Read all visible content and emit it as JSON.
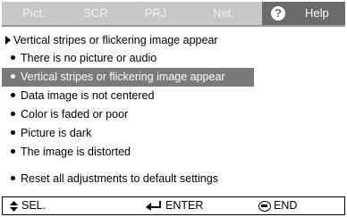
{
  "tabs": [
    {
      "label": "Pict."
    },
    {
      "label": "SCR"
    },
    {
      "label": "PRJ"
    },
    {
      "label": "Net."
    }
  ],
  "help_tab": {
    "icon": "question-icon",
    "icon_glyph": "?",
    "label": "Help"
  },
  "heading": "Vertical stripes or flickering image appear",
  "items": [
    {
      "label": "There is no picture or audio",
      "selected": false
    },
    {
      "label": "Vertical stripes or flickering image appear",
      "selected": true
    },
    {
      "label": "Data image is not centered",
      "selected": false
    },
    {
      "label": "Color is faded or poor",
      "selected": false
    },
    {
      "label": "Picture is dark",
      "selected": false
    },
    {
      "label": "The image is distorted",
      "selected": false
    }
  ],
  "reset_item": "Reset all adjustments to default settings",
  "footer": {
    "sel": {
      "icon": "up-down-arrow-icon",
      "label": "SEL."
    },
    "enter": {
      "icon": "enter-arrow-icon",
      "label": "ENTER"
    },
    "end": {
      "icon": "end-button-icon",
      "label": "END"
    }
  },
  "colors": {
    "tab_bar": "#c7c7c7",
    "active_tab": "#6b6b6b",
    "selection": "#7a7a7a"
  }
}
